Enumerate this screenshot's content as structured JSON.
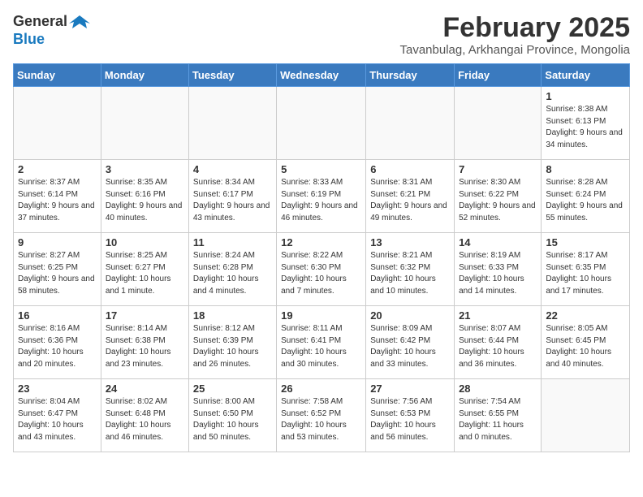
{
  "header": {
    "logo_general": "General",
    "logo_blue": "Blue",
    "month_year": "February 2025",
    "location": "Tavanbulag, Arkhangai Province, Mongolia"
  },
  "weekdays": [
    "Sunday",
    "Monday",
    "Tuesday",
    "Wednesday",
    "Thursday",
    "Friday",
    "Saturday"
  ],
  "weeks": [
    [
      {
        "day": "",
        "info": ""
      },
      {
        "day": "",
        "info": ""
      },
      {
        "day": "",
        "info": ""
      },
      {
        "day": "",
        "info": ""
      },
      {
        "day": "",
        "info": ""
      },
      {
        "day": "",
        "info": ""
      },
      {
        "day": "1",
        "info": "Sunrise: 8:38 AM\nSunset: 6:13 PM\nDaylight: 9 hours and 34 minutes."
      }
    ],
    [
      {
        "day": "2",
        "info": "Sunrise: 8:37 AM\nSunset: 6:14 PM\nDaylight: 9 hours and 37 minutes."
      },
      {
        "day": "3",
        "info": "Sunrise: 8:35 AM\nSunset: 6:16 PM\nDaylight: 9 hours and 40 minutes."
      },
      {
        "day": "4",
        "info": "Sunrise: 8:34 AM\nSunset: 6:17 PM\nDaylight: 9 hours and 43 minutes."
      },
      {
        "day": "5",
        "info": "Sunrise: 8:33 AM\nSunset: 6:19 PM\nDaylight: 9 hours and 46 minutes."
      },
      {
        "day": "6",
        "info": "Sunrise: 8:31 AM\nSunset: 6:21 PM\nDaylight: 9 hours and 49 minutes."
      },
      {
        "day": "7",
        "info": "Sunrise: 8:30 AM\nSunset: 6:22 PM\nDaylight: 9 hours and 52 minutes."
      },
      {
        "day": "8",
        "info": "Sunrise: 8:28 AM\nSunset: 6:24 PM\nDaylight: 9 hours and 55 minutes."
      }
    ],
    [
      {
        "day": "9",
        "info": "Sunrise: 8:27 AM\nSunset: 6:25 PM\nDaylight: 9 hours and 58 minutes."
      },
      {
        "day": "10",
        "info": "Sunrise: 8:25 AM\nSunset: 6:27 PM\nDaylight: 10 hours and 1 minute."
      },
      {
        "day": "11",
        "info": "Sunrise: 8:24 AM\nSunset: 6:28 PM\nDaylight: 10 hours and 4 minutes."
      },
      {
        "day": "12",
        "info": "Sunrise: 8:22 AM\nSunset: 6:30 PM\nDaylight: 10 hours and 7 minutes."
      },
      {
        "day": "13",
        "info": "Sunrise: 8:21 AM\nSunset: 6:32 PM\nDaylight: 10 hours and 10 minutes."
      },
      {
        "day": "14",
        "info": "Sunrise: 8:19 AM\nSunset: 6:33 PM\nDaylight: 10 hours and 14 minutes."
      },
      {
        "day": "15",
        "info": "Sunrise: 8:17 AM\nSunset: 6:35 PM\nDaylight: 10 hours and 17 minutes."
      }
    ],
    [
      {
        "day": "16",
        "info": "Sunrise: 8:16 AM\nSunset: 6:36 PM\nDaylight: 10 hours and 20 minutes."
      },
      {
        "day": "17",
        "info": "Sunrise: 8:14 AM\nSunset: 6:38 PM\nDaylight: 10 hours and 23 minutes."
      },
      {
        "day": "18",
        "info": "Sunrise: 8:12 AM\nSunset: 6:39 PM\nDaylight: 10 hours and 26 minutes."
      },
      {
        "day": "19",
        "info": "Sunrise: 8:11 AM\nSunset: 6:41 PM\nDaylight: 10 hours and 30 minutes."
      },
      {
        "day": "20",
        "info": "Sunrise: 8:09 AM\nSunset: 6:42 PM\nDaylight: 10 hours and 33 minutes."
      },
      {
        "day": "21",
        "info": "Sunrise: 8:07 AM\nSunset: 6:44 PM\nDaylight: 10 hours and 36 minutes."
      },
      {
        "day": "22",
        "info": "Sunrise: 8:05 AM\nSunset: 6:45 PM\nDaylight: 10 hours and 40 minutes."
      }
    ],
    [
      {
        "day": "23",
        "info": "Sunrise: 8:04 AM\nSunset: 6:47 PM\nDaylight: 10 hours and 43 minutes."
      },
      {
        "day": "24",
        "info": "Sunrise: 8:02 AM\nSunset: 6:48 PM\nDaylight: 10 hours and 46 minutes."
      },
      {
        "day": "25",
        "info": "Sunrise: 8:00 AM\nSunset: 6:50 PM\nDaylight: 10 hours and 50 minutes."
      },
      {
        "day": "26",
        "info": "Sunrise: 7:58 AM\nSunset: 6:52 PM\nDaylight: 10 hours and 53 minutes."
      },
      {
        "day": "27",
        "info": "Sunrise: 7:56 AM\nSunset: 6:53 PM\nDaylight: 10 hours and 56 minutes."
      },
      {
        "day": "28",
        "info": "Sunrise: 7:54 AM\nSunset: 6:55 PM\nDaylight: 11 hours and 0 minutes."
      },
      {
        "day": "",
        "info": ""
      }
    ]
  ]
}
